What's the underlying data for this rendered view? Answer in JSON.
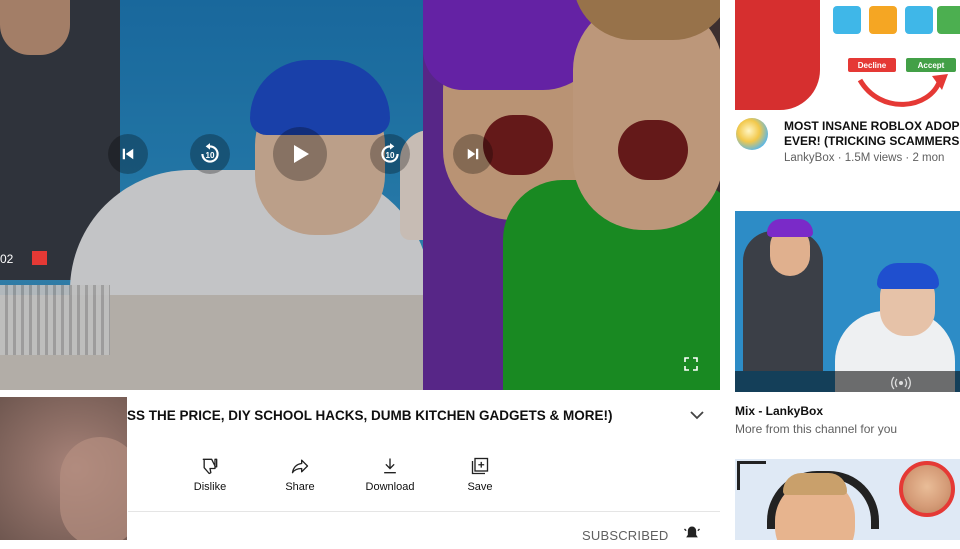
{
  "player": {
    "time_partial": "02",
    "controls": {
      "prev": "skip-previous",
      "rewind": "replay-10",
      "play": "play",
      "forward": "forward-10",
      "next": "skip-next",
      "fullscreen": "fullscreen"
    }
  },
  "video": {
    "title": "ESS THE PRICE, DIY SCHOOL HACKS, DUMB KITCHEN GADGETS & MORE!)",
    "actions": {
      "dislike_label": "Dislike",
      "share_label": "Share",
      "download_label": "Download",
      "save_label": "Save"
    },
    "subscribe_label": "SUBSCRIBED"
  },
  "recommendations": [
    {
      "title_line1": "MOST INSANE ROBLOX ADOP",
      "title_line2": "EVER! (TRICKING SCAMMERS",
      "meta": "LankyBox · 1.5M views · 2 mon",
      "thumb_decline": "Decline",
      "thumb_accept": "Accept"
    },
    {
      "title": "Mix - LankyBox",
      "subtitle": "More from this channel for you"
    }
  ],
  "colors": {
    "accent_red": "#e53935",
    "text_primary": "#0f0f0f",
    "text_secondary": "#606060"
  }
}
